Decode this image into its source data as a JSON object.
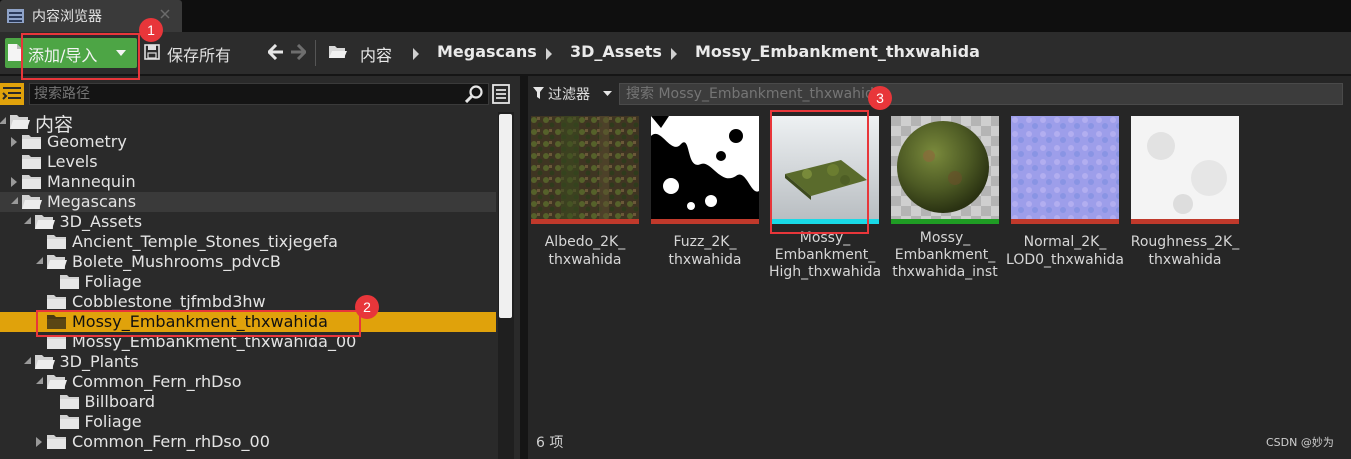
{
  "window": {
    "tab_title": "内容浏览器"
  },
  "toolbar": {
    "add_import_label": "添加/导入",
    "save_all_label": "保存所有",
    "breadcrumb": [
      "内容",
      "Megascans",
      "3D_Assets",
      "Mossy_Embankment_thxwahida"
    ]
  },
  "sources": {
    "search_placeholder": "搜索路径",
    "tree": [
      {
        "label": "内容",
        "state": "expanded"
      },
      {
        "label": "Geometry",
        "state": "collapsed"
      },
      {
        "label": "Levels",
        "state": "leaf"
      },
      {
        "label": "Mannequin",
        "state": "collapsed"
      },
      {
        "label": "Megascans",
        "state": "expanded"
      },
      {
        "label": "3D_Assets",
        "state": "expanded"
      },
      {
        "label": "Ancient_Temple_Stones_tixjegefa",
        "state": "leaf"
      },
      {
        "label": "Bolete_Mushrooms_pdvcB",
        "state": "expanded"
      },
      {
        "label": "Foliage",
        "state": "leaf"
      },
      {
        "label": "Cobblestone_tjfmbd3hw",
        "state": "leaf"
      },
      {
        "label": "Mossy_Embankment_thxwahida",
        "state": "leaf",
        "selected": true
      },
      {
        "label": "Mossy_Embankment_thxwahida_00",
        "state": "leaf"
      },
      {
        "label": "3D_Plants",
        "state": "expanded"
      },
      {
        "label": "Common_Fern_rhDso",
        "state": "expanded"
      },
      {
        "label": "Billboard",
        "state": "leaf"
      },
      {
        "label": "Foliage",
        "state": "leaf"
      },
      {
        "label": "Common_Fern_rhDso_00",
        "state": "collapsed"
      }
    ]
  },
  "assets": {
    "filters_label": "过滤器",
    "search_placeholder": "搜索 Mossy_Embankment_thxwahida",
    "items": [
      {
        "label": "Albedo_2K_ thxwahida",
        "type_color": "#c0392b",
        "thumb": "albedo"
      },
      {
        "label": "Fuzz_2K_ thxwahida",
        "type_color": "#c0392b",
        "thumb": "fuzz"
      },
      {
        "label": "Mossy_ Embankment_ High_thxwahida",
        "type_color": "#19d9e6",
        "thumb": "mesh"
      },
      {
        "label": "Mossy_ Embankment_ thxwahida_inst",
        "type_color": "#1f9c24",
        "thumb": "sphere"
      },
      {
        "label": "Normal_2K_ LOD0_thxwahida",
        "type_color": "#c0392b",
        "thumb": "normal"
      },
      {
        "label": "Roughness_2K_ thxwahida",
        "type_color": "#c0392b",
        "thumb": "roughness"
      }
    ],
    "item_count": "6 项"
  },
  "annotations": {
    "badge_1": "1",
    "badge_2": "2",
    "badge_3": "3",
    "accent": "#e8363a"
  },
  "watermark": "CSDN @妙为"
}
